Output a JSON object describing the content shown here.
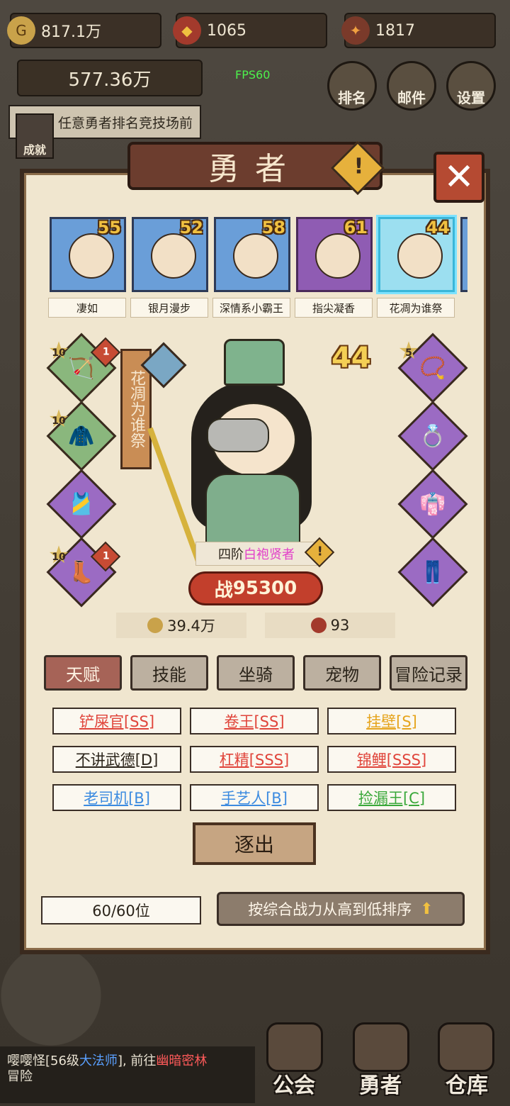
{
  "top": {
    "gold": "817.1万",
    "gems": "1065",
    "orbs": "1817",
    "gold_total": "577.36万",
    "fps": "FPS60",
    "quest_text": "任意勇者排名竞技场前",
    "quest_badge": "成就",
    "buttons": [
      "排名",
      "邮件",
      "设置"
    ]
  },
  "panel": {
    "title": "勇者",
    "close_icon": "✕",
    "warn_icon": "!"
  },
  "heroes": [
    {
      "name": "凄如",
      "level": "55",
      "color": "#6a9ed8"
    },
    {
      "name": "银月漫步",
      "level": "52",
      "color": "#6a9ed8"
    },
    {
      "name": "深情系小霸王",
      "level": "58",
      "color": "#6a9ed8"
    },
    {
      "name": "指尖凝香",
      "level": "61",
      "color": "#8f5cb3"
    },
    {
      "name": "花凋为谁祭",
      "level": "44",
      "color": "#9cdff0"
    }
  ],
  "detail": {
    "hero_name": "花凋为谁祭",
    "level": "44",
    "class_prefix": "四阶",
    "class_name": "白袍贤者",
    "power_label": "战",
    "power": "95300",
    "gold": "39.4万",
    "badge_count": "93",
    "equip_left": [
      {
        "star": "10",
        "badge": "1"
      },
      {
        "star": "10",
        "badge": ""
      },
      {
        "star": "",
        "badge": ""
      },
      {
        "star": "10",
        "badge": "1"
      }
    ],
    "equip_right": [
      {
        "star": "5"
      }
    ]
  },
  "tabs": [
    "天赋",
    "技能",
    "坐骑",
    "宠物",
    "冒险记录"
  ],
  "talents": [
    {
      "label": "铲屎官[SS]",
      "color": "#e0443a"
    },
    {
      "label": "卷王[SS]",
      "color": "#e0443a"
    },
    {
      "label": "挂壁[S]",
      "color": "#e6a41c"
    },
    {
      "label": "不讲武德[D]",
      "color": "#2b241a"
    },
    {
      "label": "杠精[SSS]",
      "color": "#e0443a"
    },
    {
      "label": "锦鲤[SSS]",
      "color": "#e0443a"
    },
    {
      "label": "老司机[B]",
      "color": "#3c8be0"
    },
    {
      "label": "手艺人[B]",
      "color": "#3c8be0"
    },
    {
      "label": "捡漏王[C]",
      "color": "#3aa83a"
    }
  ],
  "actions": {
    "expel": "逐出",
    "slots": "60/60位",
    "sort": "按综合战力从高到低排序",
    "sort_arrow": "⬆"
  },
  "chat": {
    "line1": "嘤嘤怪[56级",
    "line1_class": "大法师",
    "line1_mid": "], 前往",
    "line1_place": "幽暗密林",
    "line2": "冒险"
  },
  "bottom_nav": [
    "公会",
    "勇者",
    "仓库"
  ]
}
